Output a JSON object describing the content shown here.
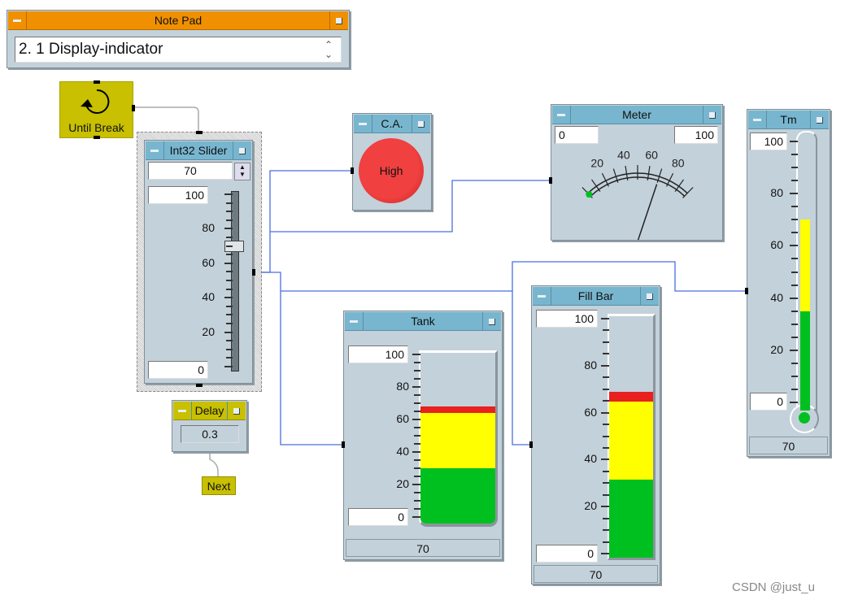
{
  "notepad": {
    "title": "Note Pad",
    "text": "2. 1  Display-indicator",
    "title_color": "#f09000"
  },
  "until_break": {
    "label": "Until Break",
    "icon": "loop-arrow-icon"
  },
  "slider": {
    "title": "Int32 Slider",
    "value": "70",
    "max": "100",
    "min": "0",
    "ticks": [
      "80",
      "60",
      "40",
      "20"
    ],
    "level": 70
  },
  "delay": {
    "title": "Delay",
    "value": "0.3"
  },
  "next": {
    "label": "Next"
  },
  "ca": {
    "title": "C.A.",
    "text": "High",
    "color": "#e83030"
  },
  "meter": {
    "title": "Meter",
    "min": "0",
    "max": "100",
    "labels": [
      "20",
      "40",
      "60",
      "80"
    ],
    "value": 70
  },
  "tank": {
    "title": "Tank",
    "max": "100",
    "min": "0",
    "ticks": [
      "80",
      "60",
      "40",
      "20"
    ],
    "value": "70",
    "level": 70,
    "bands": [
      {
        "upto": 33,
        "color": "#00c020"
      },
      {
        "upto": 66,
        "color": "#ffff00"
      },
      {
        "upto": 100,
        "color": "#e82020"
      }
    ]
  },
  "fillbar": {
    "title": "Fill Bar",
    "max": "100",
    "min": "0",
    "ticks": [
      "80",
      "60",
      "40",
      "20"
    ],
    "value": "70",
    "level": 70,
    "bands": [
      {
        "upto": 33,
        "color": "#00c020"
      },
      {
        "upto": 66,
        "color": "#ffff00"
      },
      {
        "upto": 100,
        "color": "#e82020"
      }
    ]
  },
  "tm": {
    "title": "Tm",
    "max": "100",
    "min": "0",
    "ticks": [
      "80",
      "60",
      "40",
      "20"
    ],
    "value": "70",
    "level": 70,
    "bands": [
      {
        "upto": 35,
        "color": "#00c020"
      },
      {
        "upto": 100,
        "color": "#ffff00"
      }
    ]
  },
  "watermark": "CSDN @just_u",
  "wire_color": "#4a6ee0"
}
